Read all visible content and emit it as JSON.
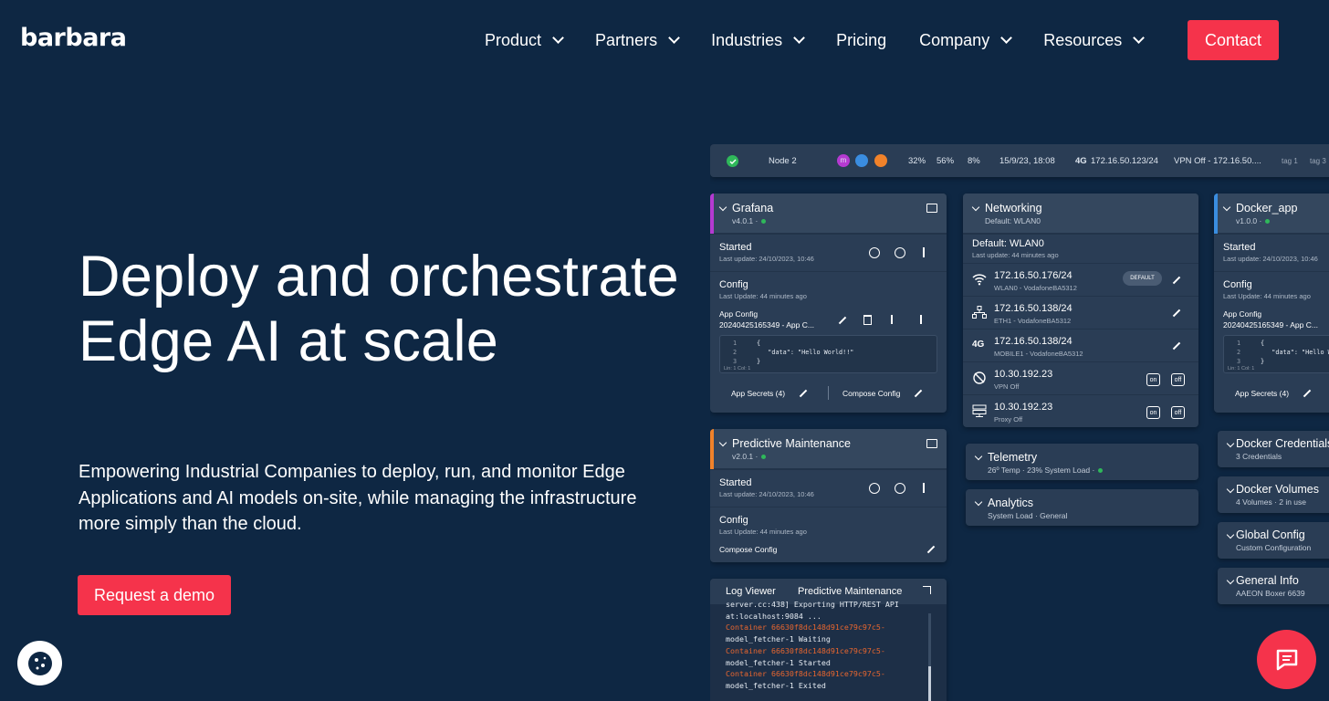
{
  "brand": {
    "logo": "barbara"
  },
  "nav": {
    "items": [
      {
        "label": "Product",
        "dropdown": true
      },
      {
        "label": "Partners",
        "dropdown": true
      },
      {
        "label": "Industries",
        "dropdown": true
      },
      {
        "label": "Pricing",
        "dropdown": false
      },
      {
        "label": "Company",
        "dropdown": true
      },
      {
        "label": "Resources",
        "dropdown": true
      }
    ],
    "contact": "Contact"
  },
  "hero": {
    "title": "Deploy and orchestrate Edge AI at scale",
    "subtitle": "Empowering Industrial Companies to deploy, run, and monitor Edge Applications and AI models on-site, while managing the infrastructure more simply than the cloud.",
    "cta": "Request a demo"
  },
  "colors": {
    "accent": "#f5334b",
    "background": "#0e2743",
    "card": "#2a3d55",
    "ok": "#2fb85a"
  },
  "dashboard": {
    "node": {
      "name": "Node 2",
      "cpu": "32%",
      "mem": "56%",
      "disk": "8%",
      "date": "15/9/23, 18:08",
      "net": "4G",
      "ip": "172.16.50.123/24",
      "vpn": "VPN Off - 172.16.50....",
      "tag1": "tag 1",
      "tag3": "tag 3",
      "badge1": "m"
    },
    "grafana": {
      "name": "Grafana",
      "version": "v4.0.1 ·",
      "status": "Started",
      "status_meta": "Last update: 24/10/2023, 10:46",
      "config": "Config",
      "config_meta": "Last Update: 44 minutes ago",
      "app_config": "App Config",
      "app_config_file": "20240425165349 - App C...",
      "code1": "{",
      "code2": "\"data\": \"Hello World!!\"",
      "code3": "}",
      "code_meta": "Lin: 1   Col: 1",
      "secrets": "App Secrets (4)",
      "compose": "Compose Config"
    },
    "predictive": {
      "name": "Predictive Maintenance",
      "version": "v2.0.1 ·",
      "status": "Started",
      "status_meta": "Last update: 24/10/2023, 10:46",
      "config": "Config",
      "config_meta": "Last Update: 44 minutes ago",
      "compose": "Compose Config"
    },
    "networking": {
      "name": "Networking",
      "sub": "Default: WLAN0",
      "default_title": "Default: WLAN0",
      "default_meta": "Last update: 44 minutes ago",
      "rows": [
        {
          "ip": "172.16.50.176/24",
          "meta": "WLAN0 - VodafoneBA5312",
          "icon": "wifi-icon",
          "badge": "DEFAULT"
        },
        {
          "ip": "172.16.50.138/24",
          "meta": "ETH1 - VodafoneBA5312",
          "icon": "ethernet-icon"
        },
        {
          "ip": "172.16.50.138/24",
          "meta": "MOBILE1 - VodafoneBA5312",
          "icon": "4g-icon",
          "label": "4G"
        },
        {
          "ip": "10.30.192.23",
          "meta": "VPN Off",
          "icon": "vpn-off-icon",
          "on": "on",
          "off": "off"
        },
        {
          "ip": "10.30.192.23",
          "meta": "Proxy Off",
          "icon": "proxy-icon",
          "on": "on",
          "off": "off"
        }
      ]
    },
    "telemetry": {
      "name": "Telemetry",
      "meta": "26º Temp · 23% System Load ·"
    },
    "analytics": {
      "name": "Analytics",
      "meta": "System Load  ·  General"
    },
    "docker_app": {
      "name": "Docker_app",
      "version": "v1.0.0 ·",
      "status": "Started",
      "status_meta": "Last update: 24/10/2023, 10:46",
      "config": "Config",
      "config_meta": "Last Update: 44 minutes ago",
      "app_config": "App Config",
      "app_config_file": "20240425165349 - App C...",
      "code1": "{",
      "code2": "\"data\": \"Hello W",
      "code3": "}",
      "code_meta": "Lin: 1   Col: 1",
      "secrets": "App Secrets (4)"
    },
    "right_list": [
      {
        "name": "Docker Credentials",
        "meta": "3 Credentials"
      },
      {
        "name": "Docker Volumes",
        "meta": "4 Volumes  ·  2 in use"
      },
      {
        "name": "Global Config",
        "meta": "Custom Configuration"
      },
      {
        "name": "General Info",
        "meta": "AAEON Boxer 6639"
      }
    ],
    "log": {
      "tab1": "Log Viewer",
      "tab2": "Predictive Maintenance",
      "lines": [
        {
          "text": "server.cc:438] Exporting HTTP/REST API",
          "color": "w"
        },
        {
          "text": "at:localhost:9084 ...",
          "color": "w"
        },
        {
          "text": "Container 66630f8dc148d91ce79c97c5-",
          "color": "o"
        },
        {
          "text": "model_fetcher-1 Waiting",
          "color": "w"
        },
        {
          "text": "Container 66630f8dc148d91ce79c97c5-",
          "color": "o"
        },
        {
          "text": "model_fetcher-1 Started",
          "color": "w"
        },
        {
          "text": "Container 66630f8dc148d91ce79c97c5-",
          "color": "o"
        },
        {
          "text": "model_fetcher-1 Exited",
          "color": "w"
        }
      ]
    }
  }
}
